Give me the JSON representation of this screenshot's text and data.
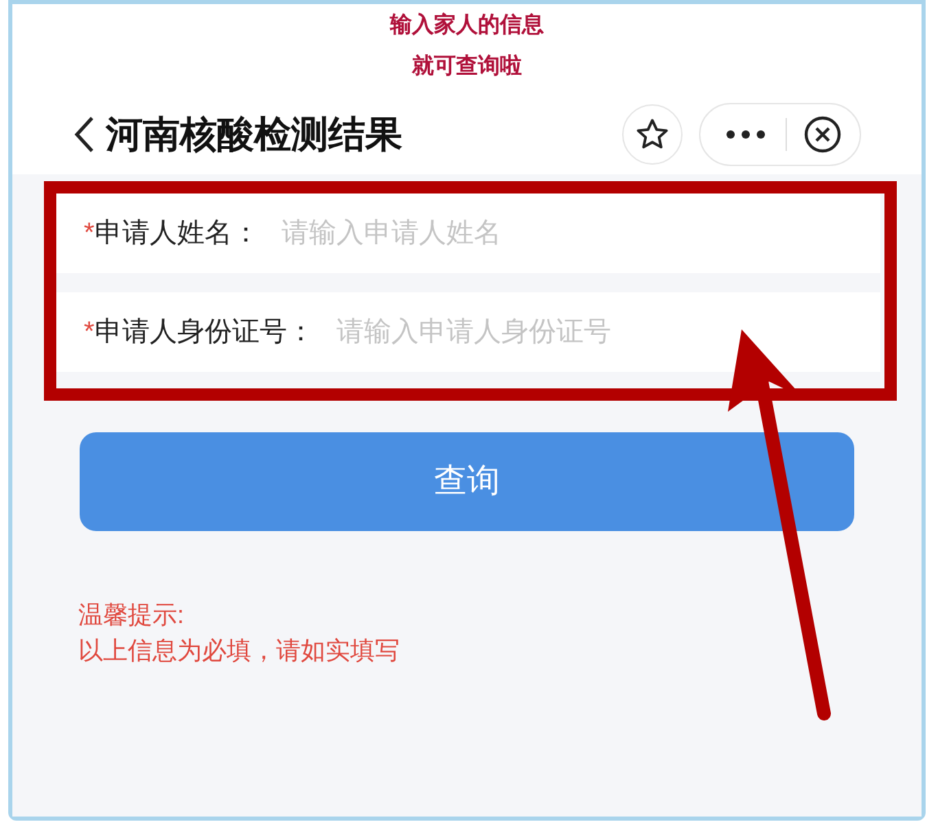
{
  "caption": [
    "输入家人的信息",
    "就可查询啦"
  ],
  "header": {
    "title": "河南核酸检测结果"
  },
  "fields": [
    {
      "required_mark": "*",
      "label": "申请人姓名：",
      "placeholder": "请输入申请人姓名"
    },
    {
      "required_mark": "*",
      "label": "申请人身份证号：",
      "placeholder": "请输入申请人身份证号"
    }
  ],
  "submit_button": "查询",
  "tip": [
    "温馨提示:",
    "以上信息为必填，请如实填写"
  ]
}
